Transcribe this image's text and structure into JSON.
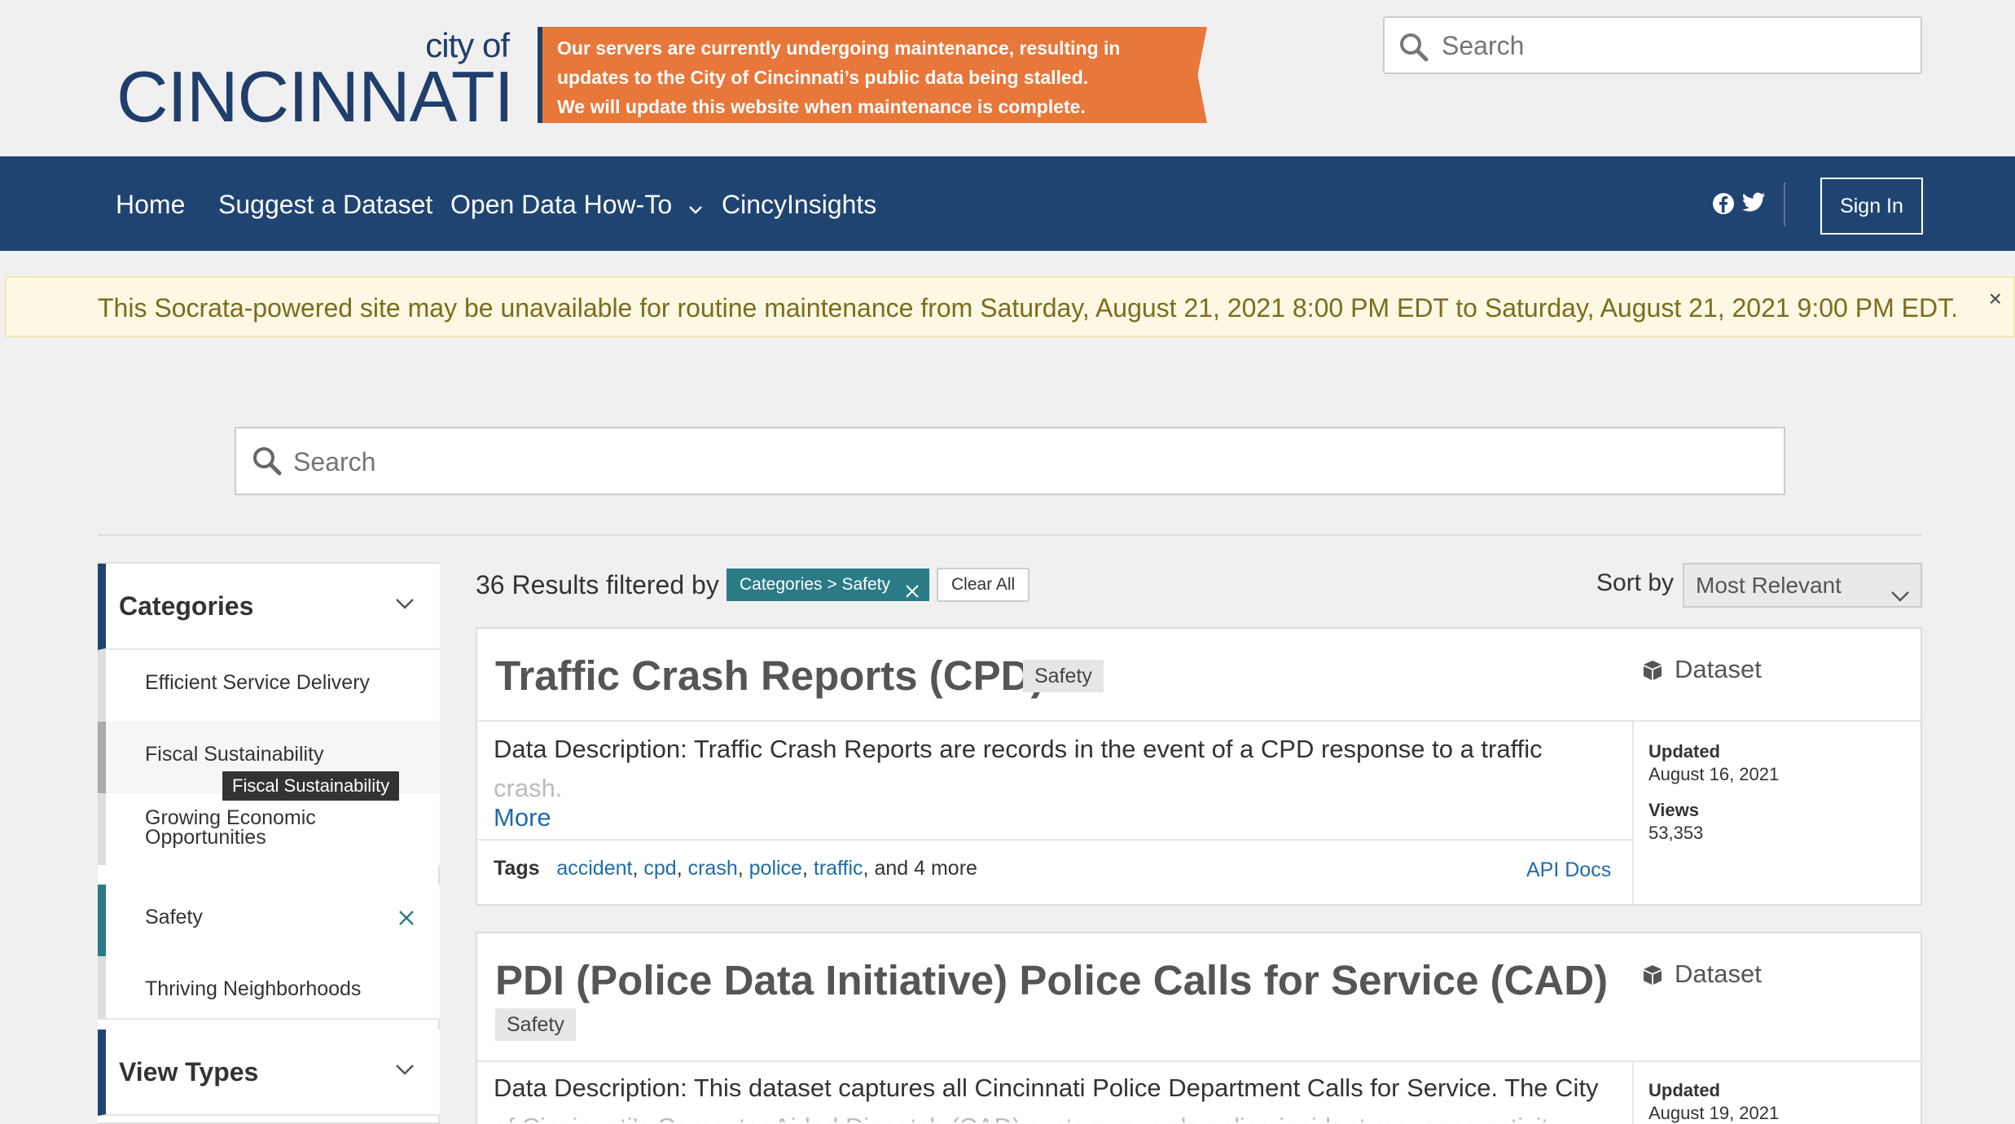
{
  "header": {
    "logo_small": "city of",
    "logo_big": "CINCINNATI",
    "banner_lines": [
      "Our servers are currently undergoing maintenance, resulting in",
      "updates to the City of Cincinnati’s public data being stalled.",
      "We will update this website when maintenance is complete."
    ],
    "banner_color": "#e8773a",
    "search_placeholder": "Search"
  },
  "nav": {
    "items": [
      "Home",
      "Suggest a Dataset",
      "Open Data How-To",
      "CincyInsights"
    ],
    "signin_label": "Sign In",
    "background": "#1f4472"
  },
  "notice": {
    "prefix": "This Socrata-powered site may be unavailable for routine maintenance from",
    "start": "Saturday, August 21, 2021 8:00 PM EDT",
    "middle": "to",
    "end": "Saturday, August 21, 2021 9:00 PM EDT",
    "suffix": ".",
    "close": "×"
  },
  "main_search": {
    "placeholder": "Search"
  },
  "sidebar": {
    "categories_title": "Categories",
    "categories": [
      "Efficient Service Delivery",
      "Fiscal Sustainability",
      "Growing Economic Opportunities",
      "Safety",
      "Thriving Neighborhoods"
    ],
    "active_category": "Safety",
    "tooltip": "Fiscal Sustainability",
    "view_types_title": "View Types"
  },
  "results": {
    "count_text": "36 Results filtered by",
    "filter_chip": "Categories > Safety",
    "clear_all": "Clear All",
    "sort_label": "Sort by",
    "sort_value": "Most Relevant"
  },
  "cards": [
    {
      "title": "Traffic Crash Reports (CPD)",
      "category": "Safety",
      "type": "Dataset",
      "desc_line1": "Data Description: Traffic Crash Reports are records in the event of a CPD response to a traffic",
      "desc_line2": "crash.",
      "more": "More",
      "tags_label": "Tags",
      "tags": [
        "accident",
        "cpd",
        "crash",
        "police",
        "traffic"
      ],
      "tags_more": "and 4 more",
      "api_docs": "API Docs",
      "updated_label": "Updated",
      "updated_value": "August 16, 2021",
      "views_label": "Views",
      "views_value": "53,353"
    },
    {
      "title": "PDI (Police Data Initiative) Police Calls for Service (CAD)",
      "category": "Safety",
      "type": "Dataset",
      "desc_line1": "Data Description: This dataset captures all Cincinnati Police Department Calls for Service. The City",
      "desc_line2": "of Cincinnati’s Computer Aided Dispatch (CAD) system records police incident response activity,",
      "updated_label": "Updated",
      "updated_value": "August 19, 2021"
    }
  ]
}
